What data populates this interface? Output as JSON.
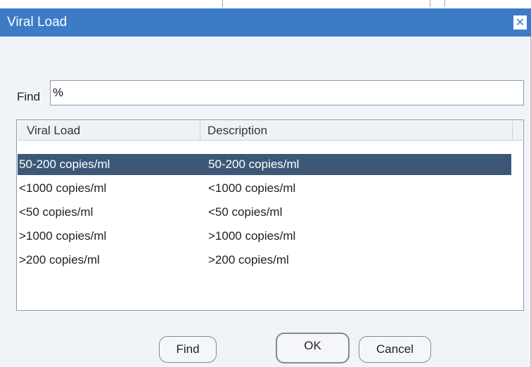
{
  "dialog": {
    "title": "Viral Load",
    "close_symbol": "✕"
  },
  "find": {
    "label": "Find",
    "value": "%"
  },
  "list": {
    "columns": [
      "Viral Load",
      "Description"
    ],
    "rows": [
      {
        "viral_load": "50-200 copies/ml",
        "description": "50-200 copies/ml",
        "selected": true
      },
      {
        "viral_load": "<1000 copies/ml",
        "description": "<1000 copies/ml",
        "selected": false
      },
      {
        "viral_load": "<50 copies/ml",
        "description": "<50 copies/ml",
        "selected": false
      },
      {
        "viral_load": ">1000 copies/ml",
        "description": ">1000 copies/ml",
        "selected": false
      },
      {
        "viral_load": ">200 copies/ml",
        "description": ">200 copies/ml",
        "selected": false
      }
    ]
  },
  "buttons": {
    "find_label": "Find",
    "ok_label": "OK",
    "cancel_label": "Cancel"
  },
  "colors": {
    "titlebar": "#3d7bc7",
    "selected_row": "#3c5876",
    "dialog_bg": "#f0f4f8"
  }
}
